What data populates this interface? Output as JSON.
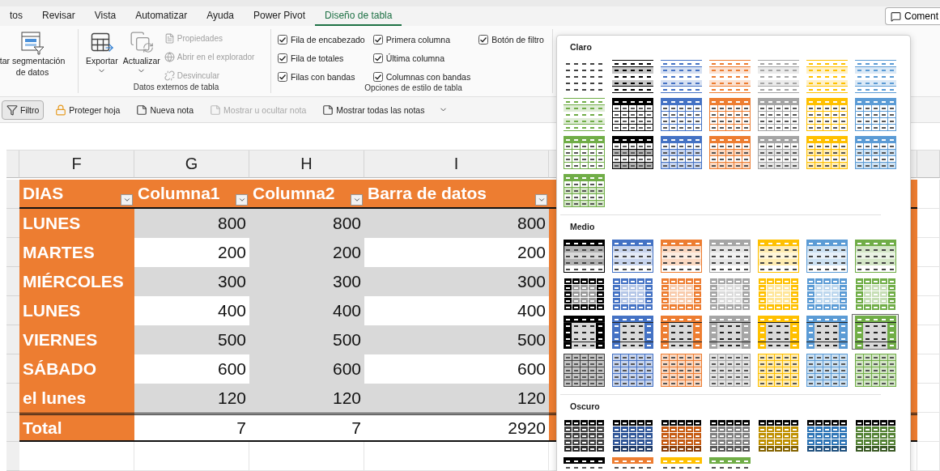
{
  "tabs": [
    {
      "label": "tos",
      "selected": false
    },
    {
      "label": "Revisar",
      "selected": false
    },
    {
      "label": "Vista",
      "selected": false
    },
    {
      "label": "Automatizar",
      "selected": false
    },
    {
      "label": "Ayuda",
      "selected": false
    },
    {
      "label": "Power Pivot",
      "selected": false
    },
    {
      "label": "Diseño de tabla",
      "selected": true
    }
  ],
  "comment_button": {
    "label": "Coment"
  },
  "slicer_button": {
    "label": "tar segmentación de datos"
  },
  "external_group": {
    "label": "Datos externos de tabla",
    "large_buttons": [
      {
        "label": "Exportar",
        "kind": "export"
      },
      {
        "label": "Actualizar",
        "kind": "refresh"
      }
    ],
    "small_buttons": [
      {
        "label": "Propiedades",
        "kind": "properties",
        "disabled": true
      },
      {
        "label": "Abrir en el explorador",
        "kind": "browser",
        "disabled": true
      },
      {
        "label": "Desvincular",
        "kind": "unlink",
        "disabled": true
      }
    ]
  },
  "style_options": {
    "label": "Opciones de estilo de tabla",
    "columns": [
      [
        {
          "label": "Fila de encabezado",
          "kind": "header_row",
          "checked": true
        },
        {
          "label": "Fila de totales",
          "kind": "total_row",
          "checked": true
        },
        {
          "label": "Filas con bandas",
          "kind": "banded_rows",
          "checked": true
        }
      ],
      [
        {
          "label": "Primera columna",
          "kind": "first_column",
          "checked": true
        },
        {
          "label": "Última columna",
          "kind": "last_column",
          "checked": true
        },
        {
          "label": "Columnas con bandas",
          "kind": "banded_columns",
          "checked": true
        }
      ],
      [
        {
          "label": "Botón de filtro",
          "kind": "filter_button",
          "checked": true
        }
      ]
    ]
  },
  "quick_bar": [
    {
      "label": "Filtro",
      "kind": "filter",
      "on": true,
      "disabled": false
    },
    {
      "label": "Proteger hoja",
      "kind": "protect",
      "on": false,
      "disabled": false
    },
    {
      "label": "Nueva nota",
      "kind": "new_note",
      "on": false,
      "disabled": false
    },
    {
      "label": "Mostrar u ocultar nota",
      "kind": "toggle_note",
      "on": false,
      "disabled": true
    },
    {
      "label": "Mostrar todas las notas",
      "kind": "all_notes",
      "on": false,
      "disabled": false
    }
  ],
  "sheet": {
    "column_letters": [
      "F",
      "G",
      "H",
      "I"
    ],
    "table": {
      "headers": [
        "DIAS",
        "Columna1",
        "Columna2",
        "Barra de datos"
      ],
      "rows": [
        [
          "LUNES",
          "800",
          "800",
          "800"
        ],
        [
          "MARTES",
          "200",
          "200",
          "200"
        ],
        [
          "MIÉRCOLES",
          "300",
          "300",
          "300"
        ],
        [
          "LUNES",
          "400",
          "400",
          "400"
        ],
        [
          "VIERNES",
          "500",
          "500",
          "500"
        ],
        [
          "SÁBADO",
          "600",
          "600",
          "600"
        ],
        [
          "el lunes",
          "120",
          "120",
          "120"
        ]
      ],
      "total": [
        "Total",
        "7",
        "7",
        "2920"
      ]
    }
  },
  "gallery": {
    "sections": [
      {
        "title": "Claro",
        "styles": [
          {
            "kind": "plain",
            "color": "#404040",
            "selected": false
          },
          {
            "kind": "banded",
            "color": "#000000",
            "selected": false
          },
          {
            "kind": "banded",
            "color": "#4472c4",
            "selected": false
          },
          {
            "kind": "banded",
            "color": "#ed7d31",
            "selected": false
          },
          {
            "kind": "banded",
            "color": "#a5a5a5",
            "selected": false
          },
          {
            "kind": "banded",
            "color": "#ffc000",
            "selected": false
          },
          {
            "kind": "banded",
            "color": "#5b9bd5",
            "selected": false
          },
          {
            "kind": "banded",
            "color": "#70ad47",
            "selected": false
          },
          {
            "kind": "grid",
            "color": "#000000",
            "selected": false
          },
          {
            "kind": "grid",
            "color": "#4472c4",
            "selected": false
          },
          {
            "kind": "grid",
            "color": "#ed7d31",
            "selected": false
          },
          {
            "kind": "grid",
            "color": "#a5a5a5",
            "selected": false
          },
          {
            "kind": "grid",
            "color": "#ffc000",
            "selected": false
          },
          {
            "kind": "grid",
            "color": "#5b9bd5",
            "selected": false
          },
          {
            "kind": "grid",
            "color": "#70ad47",
            "selected": false
          },
          {
            "kind": "gridbanded",
            "color": "#000000",
            "selected": false
          },
          {
            "kind": "gridbanded",
            "color": "#4472c4",
            "selected": false
          },
          {
            "kind": "gridbanded",
            "color": "#ed7d31",
            "selected": false
          },
          {
            "kind": "gridbanded",
            "color": "#a5a5a5",
            "selected": false
          },
          {
            "kind": "gridbanded",
            "color": "#ffc000",
            "selected": false
          },
          {
            "kind": "gridbanded",
            "color": "#5b9bd5",
            "selected": false
          },
          {
            "kind": "gridbanded",
            "color": "#70ad47",
            "selected": false
          }
        ]
      },
      {
        "title": "Medio",
        "styles": [
          {
            "kind": "filled",
            "color": "#000000",
            "selected": false
          },
          {
            "kind": "filled",
            "color": "#4472c4",
            "selected": false
          },
          {
            "kind": "filled",
            "color": "#ed7d31",
            "selected": false
          },
          {
            "kind": "filled",
            "color": "#a5a5a5",
            "selected": false
          },
          {
            "kind": "filled",
            "color": "#ffc000",
            "selected": false
          },
          {
            "kind": "filled",
            "color": "#5b9bd5",
            "selected": false
          },
          {
            "kind": "filled",
            "color": "#70ad47",
            "selected": false
          },
          {
            "kind": "bold",
            "color": "#000000",
            "selected": false
          },
          {
            "kind": "bold",
            "color": "#4472c4",
            "selected": false
          },
          {
            "kind": "bold",
            "color": "#ed7d31",
            "selected": false
          },
          {
            "kind": "bold",
            "color": "#a5a5a5",
            "selected": false
          },
          {
            "kind": "bold",
            "color": "#ffc000",
            "selected": false
          },
          {
            "kind": "bold",
            "color": "#5b9bd5",
            "selected": false
          },
          {
            "kind": "bold",
            "color": "#70ad47",
            "selected": false
          },
          {
            "kind": "frame",
            "color": "#000000",
            "selected": false
          },
          {
            "kind": "frame",
            "color": "#4472c4",
            "selected": false
          },
          {
            "kind": "frame",
            "color": "#ed7d31",
            "selected": false
          },
          {
            "kind": "frame",
            "color": "#a5a5a5",
            "selected": false
          },
          {
            "kind": "frame",
            "color": "#ffc000",
            "selected": false
          },
          {
            "kind": "frame",
            "color": "#5b9bd5",
            "selected": false
          },
          {
            "kind": "frame",
            "color": "#70ad47",
            "selected": true
          },
          {
            "kind": "lightgrid",
            "color": "#404040",
            "selected": false
          },
          {
            "kind": "lightgrid",
            "color": "#4472c4",
            "selected": false
          },
          {
            "kind": "lightgrid",
            "color": "#ed7d31",
            "selected": false
          },
          {
            "kind": "lightgrid",
            "color": "#a5a5a5",
            "selected": false
          },
          {
            "kind": "lightgrid",
            "color": "#ffc000",
            "selected": false
          },
          {
            "kind": "lightgrid",
            "color": "#5b9bd5",
            "selected": false
          },
          {
            "kind": "lightgrid",
            "color": "#70ad47",
            "selected": false
          }
        ]
      },
      {
        "title": "Oscuro",
        "styles": [
          {
            "kind": "dark",
            "color": "#404040",
            "selected": false
          },
          {
            "kind": "dark",
            "color": "#2f5597",
            "selected": false
          },
          {
            "kind": "dark",
            "color": "#c55a11",
            "selected": false
          },
          {
            "kind": "dark",
            "color": "#7f7f7f",
            "selected": false
          },
          {
            "kind": "dark",
            "color": "#bf9000",
            "selected": false
          },
          {
            "kind": "dark",
            "color": "#2e75b6",
            "selected": false
          },
          {
            "kind": "dark",
            "color": "#548235",
            "selected": false
          },
          {
            "kind": "header",
            "color": "#000000",
            "selected": false
          },
          {
            "kind": "header",
            "color": "#ed7d31",
            "selected": false
          },
          {
            "kind": "header",
            "color": "#ffc000",
            "selected": false
          },
          {
            "kind": "header",
            "color": "#70ad47",
            "selected": false
          }
        ]
      }
    ]
  }
}
